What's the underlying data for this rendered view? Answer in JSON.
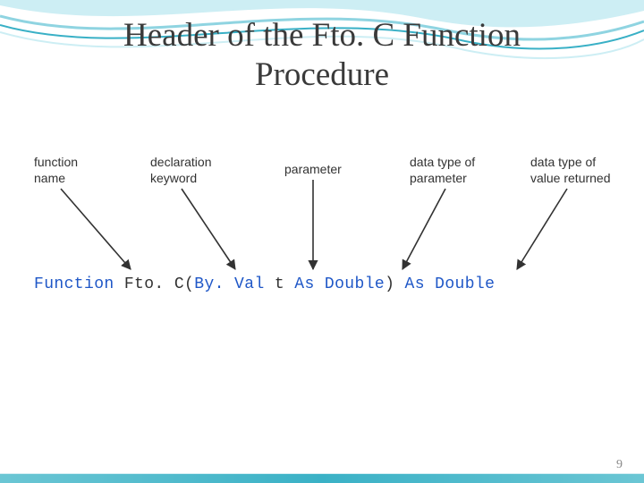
{
  "title": {
    "line1": "Header of the Fto. C Function",
    "line2": "Procedure"
  },
  "labels": {
    "func_name": "function\nname",
    "decl_keyword": "declaration\nkeyword",
    "parameter": "parameter",
    "type_param": "data type of\nparameter",
    "type_return": "data type of\nvalue returned"
  },
  "code": {
    "kw_function": "Function",
    "ident": "Fto. C",
    "open_paren": "(",
    "kw_byval": "By. Val",
    "param_name": " t ",
    "kw_as1": "As",
    "type1": "Double",
    "close_paren": ")",
    "kw_as2": "As",
    "type2": "Double"
  },
  "page_number": "9",
  "colors": {
    "wave_light": "#cdeef4",
    "wave_mid": "#8fd4e1",
    "wave_dark": "#39b0c6"
  }
}
